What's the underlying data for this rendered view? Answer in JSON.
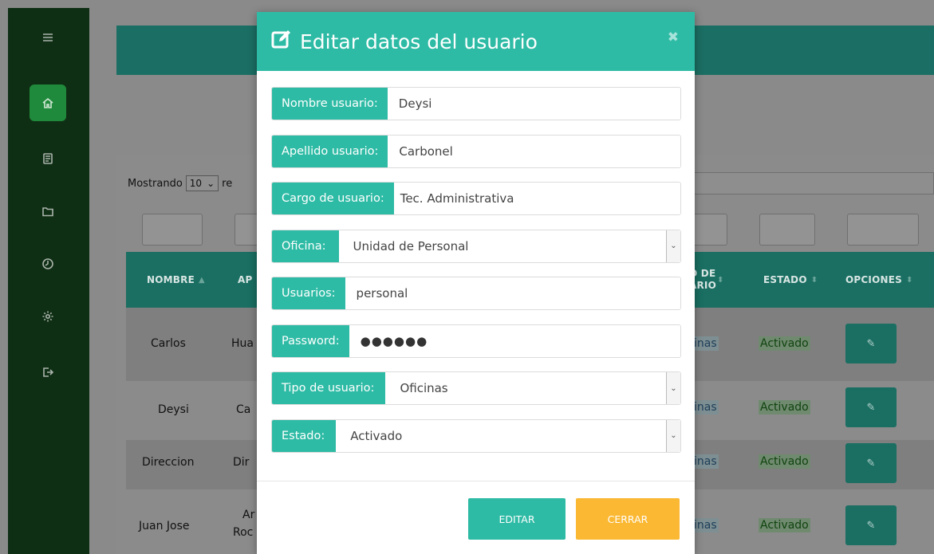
{
  "modal": {
    "title": "Editar datos del usuario",
    "close_symbol": "✖",
    "fields": {
      "nombre": {
        "label": "Nombre usuario:",
        "value": "Deysi"
      },
      "apellido": {
        "label": "Apellido usuario:",
        "value": "Carbonel"
      },
      "cargo": {
        "label": "Cargo de usuario:",
        "value": "Tec. Administrativa"
      },
      "oficina": {
        "label": "Oficina:",
        "value": "Unidad de Personal"
      },
      "usuario": {
        "label": "Usuarios:",
        "value": "personal"
      },
      "password": {
        "label": "Password:",
        "value": "●●●●●●"
      },
      "tipo": {
        "label": "Tipo de usuario:",
        "value": "Oficinas"
      },
      "estado": {
        "label": "Estado:",
        "value": "Activado"
      }
    },
    "buttons": {
      "editar": "EDITAR",
      "cerrar": "CERRAR"
    }
  },
  "table": {
    "show_prefix": "Mostrando",
    "show_count": "10",
    "show_suffix": "re",
    "headers": {
      "nombre": "NOMBRE",
      "apellido": "AP",
      "tipo_line1": "O DE",
      "tipo_line2": "ARIO",
      "estado": "ESTADO",
      "opciones": "OPCIONES"
    },
    "rows": [
      {
        "nombre": "Carlos",
        "apellido": "Hua",
        "tipo": "inas",
        "estado": "Activado"
      },
      {
        "nombre": "Deysi",
        "apellido": "Ca",
        "tipo": "inas",
        "estado": "Activado"
      },
      {
        "nombre": "Direccion",
        "apellido": "Dir",
        "tipo": "inas",
        "estado": "Activado"
      },
      {
        "nombre": "Juan Jose",
        "apellido_line1": "Ar",
        "apellido_line2": "Roc",
        "tipo": "inas",
        "estado": "Activado"
      }
    ]
  },
  "icons": {
    "menu": "menu-icon",
    "home": "home-icon",
    "document": "document-icon",
    "folder": "folder-icon",
    "clock": "clock-icon",
    "settings": "gear-icon",
    "logout": "logout-icon",
    "edit": "edit-icon"
  },
  "colors": {
    "accent": "#2ebba5",
    "warning": "#fbb832",
    "sidebar": "#0f2f14",
    "sidebar_active": "#1f8a3b"
  }
}
